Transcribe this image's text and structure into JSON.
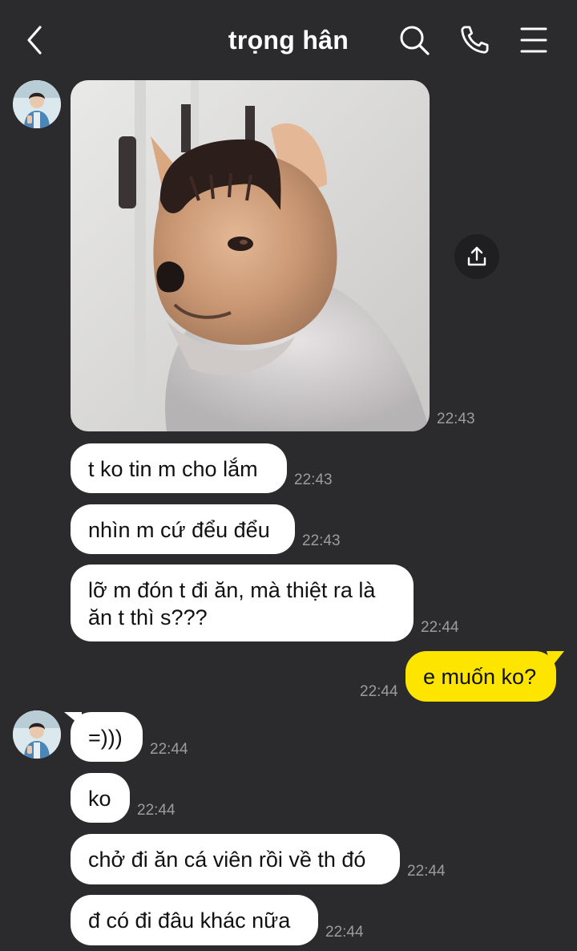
{
  "header": {
    "title": "trọng hân",
    "back_icon": "chevron-left-icon",
    "search_icon": "search-icon",
    "call_icon": "phone-icon",
    "menu_icon": "menu-icon"
  },
  "colors": {
    "background": "#2b2b2d",
    "incoming_bubble": "#ffffff",
    "outgoing_bubble": "#fee500",
    "timestamp": "#9c9c9e"
  },
  "messages": [
    {
      "type": "photo",
      "sender": "trọng hân",
      "time": "22:43"
    },
    {
      "type": "text",
      "sender": "trọng hân",
      "text": "t ko tin m cho lắm",
      "time": "22:43"
    },
    {
      "type": "text",
      "sender": "trọng hân",
      "text": "nhìn m cứ đểu đểu",
      "time": "22:43"
    },
    {
      "type": "text",
      "sender": "trọng hân",
      "text": "lỡ m đón t đi ăn, mà thiệt ra là ăn t thì s???",
      "time": "22:44"
    },
    {
      "type": "text",
      "sender": "me",
      "text": "e muốn ko?",
      "time": "22:44"
    },
    {
      "type": "text",
      "sender": "trọng hân",
      "text": "=)))",
      "time": "22:44"
    },
    {
      "type": "text",
      "sender": "trọng hân",
      "text": "ko",
      "time": "22:44"
    },
    {
      "type": "text",
      "sender": "trọng hân",
      "text": "chở đi ăn cá viên rồi về th đó",
      "time": "22:44"
    },
    {
      "type": "text",
      "sender": "trọng hân",
      "text": "đ có đi đâu khác nữa",
      "time": "22:44"
    }
  ]
}
